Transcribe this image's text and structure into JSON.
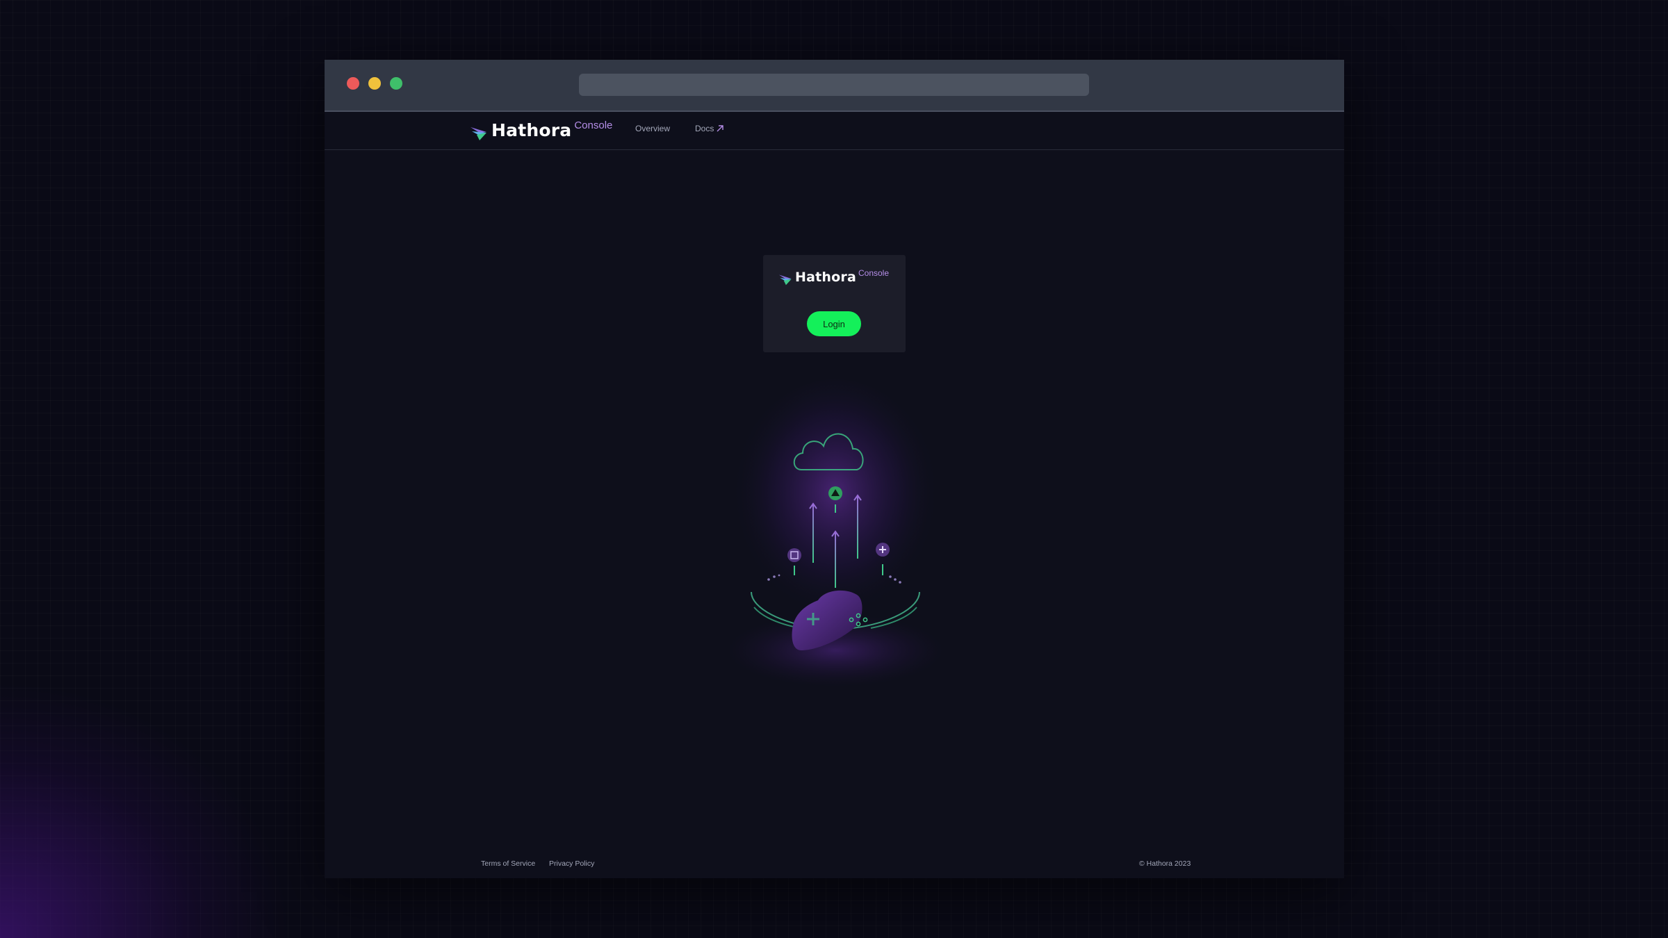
{
  "browser": {
    "url": "",
    "controls": [
      "close",
      "minimize",
      "maximize"
    ]
  },
  "nav": {
    "logo": {
      "word": "Hathora",
      "sup": "Console"
    },
    "links": [
      {
        "label": "Overview"
      },
      {
        "label": "Docs",
        "icon": "external-arrow-icon"
      }
    ]
  },
  "login_card": {
    "logo": {
      "word": "Hathora",
      "sup": "Console"
    },
    "button_label": "Login"
  },
  "illustration": {
    "icons": [
      "cloud-icon",
      "arrow-up-icon",
      "game-controller-icon",
      "triangle-button-icon",
      "square-button-icon",
      "plus-button-icon"
    ]
  },
  "footer": {
    "links": [
      "Terms of Service",
      "Privacy Policy"
    ],
    "copyright": "© Hathora 2023"
  },
  "colors": {
    "accent_green": "#14f05a",
    "accent_purple": "#b58ee8",
    "background": "#0e0f1b",
    "titlebar": "#323845"
  }
}
